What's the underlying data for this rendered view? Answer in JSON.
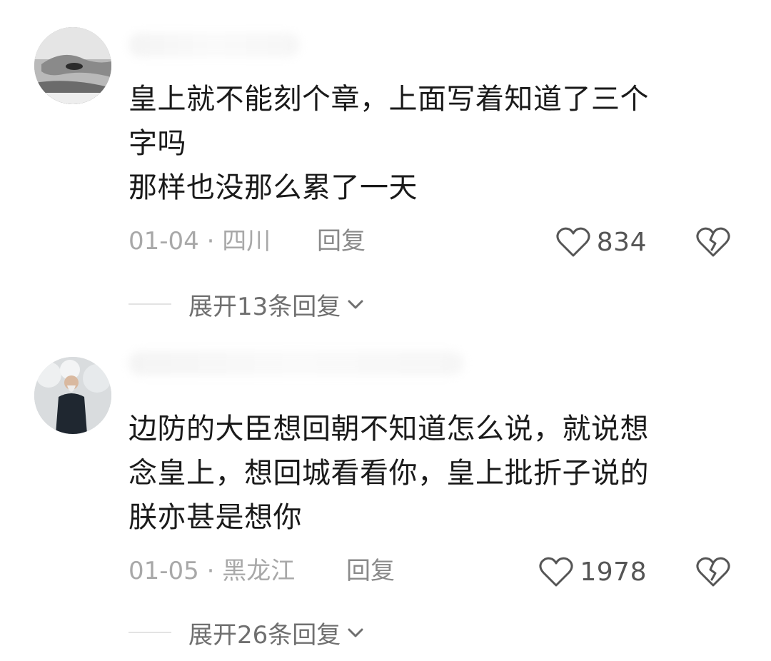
{
  "comments": [
    {
      "content_lines": [
        "皇上就不能刻个章，上面写着知道了三个",
        "字吗",
        "那样也没那么累了一天"
      ],
      "date": "01-04",
      "separator": "·",
      "location": "四川",
      "reply_label": "回复",
      "likes": "834",
      "expand_label": "展开13条回复",
      "icons": {
        "like": "heart-icon",
        "dislike": "broken-heart-icon",
        "expand": "chevron-down-icon"
      }
    },
    {
      "content_lines": [
        "边防的大臣想回朝不知道怎么说，就说想",
        "念皇上，想回城看看你，皇上批折子说的",
        "朕亦甚是想你"
      ],
      "date": "01-05",
      "separator": "·",
      "location": "黑龙江",
      "reply_label": "回复",
      "likes": "1978",
      "expand_label": "展开26条回复",
      "icons": {
        "like": "heart-icon",
        "dislike": "broken-heart-icon",
        "expand": "chevron-down-icon"
      }
    }
  ],
  "colors": {
    "text_primary": "#1a1a1a",
    "text_meta": "#a8a8a8",
    "text_secondary": "#6f6f6f",
    "icon_stroke": "#555555"
  }
}
